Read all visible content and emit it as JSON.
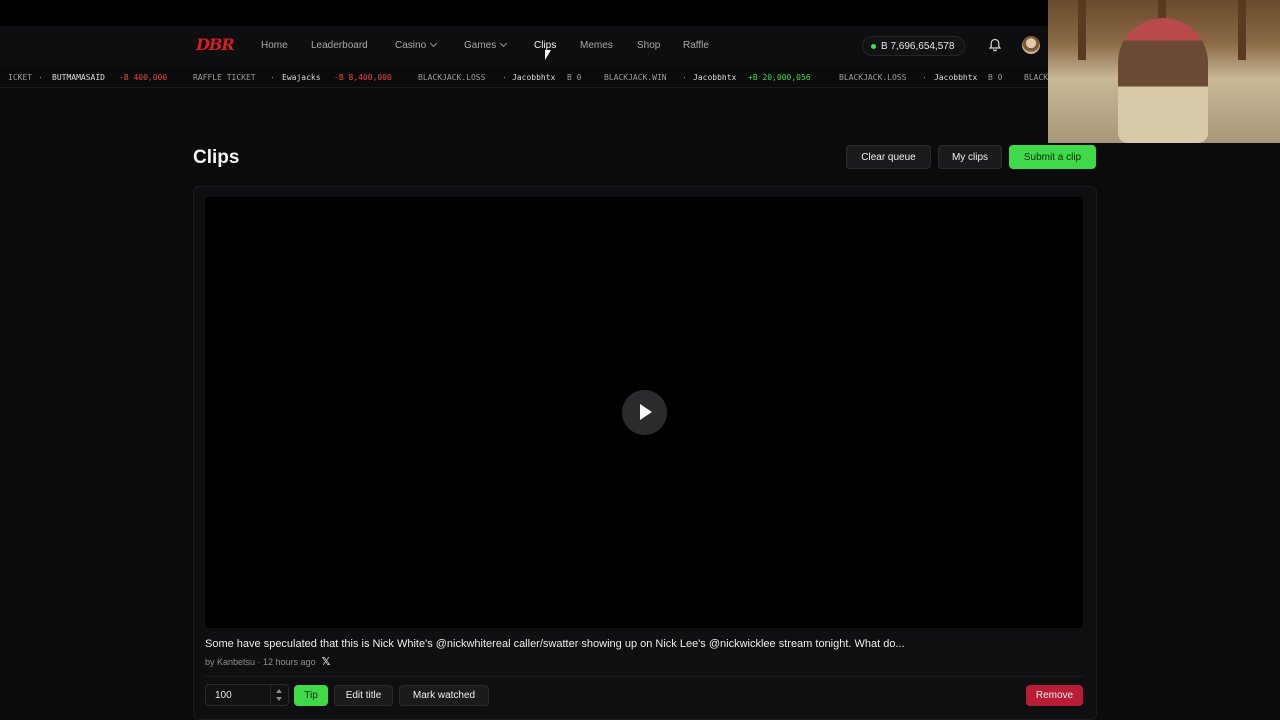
{
  "brand": {
    "logo_text": "DBR",
    "accent": "#d61f1f"
  },
  "nav": {
    "items": [
      {
        "label": "Home"
      },
      {
        "label": "Leaderboard"
      },
      {
        "label": "Casino",
        "has_dropdown": true
      },
      {
        "label": "Games",
        "has_dropdown": true
      },
      {
        "label": "Clips",
        "active": true
      },
      {
        "label": "Memes"
      },
      {
        "label": "Shop"
      },
      {
        "label": "Raffle"
      }
    ],
    "balance": "B 7,696,654,578",
    "icons": [
      "bell-icon",
      "avatar"
    ]
  },
  "ticker": [
    {
      "label": "ICKET",
      "kind": "label"
    },
    {
      "label": "BUTMAMASAID",
      "kind": "user"
    },
    {
      "label": "-B 400,000",
      "kind": "neg"
    },
    {
      "label": "RAFFLE TICKET",
      "kind": "label"
    },
    {
      "label": "Ewajacks",
      "kind": "user"
    },
    {
      "label": "-B 8,400,000",
      "kind": "neg"
    },
    {
      "label": "BLACKJACK.LOSS",
      "kind": "label"
    },
    {
      "label": "Jacobbhtx",
      "kind": "user"
    },
    {
      "label": "B 0",
      "kind": "label"
    },
    {
      "label": "BLACKJACK.WIN",
      "kind": "label"
    },
    {
      "label": "Jacobbhtx",
      "kind": "user"
    },
    {
      "label": "+B 20,000,056",
      "kind": "pos"
    },
    {
      "label": "BLACKJACK.LOSS",
      "kind": "label"
    },
    {
      "label": "Jacobbhtx",
      "kind": "user"
    },
    {
      "label": "B 0",
      "kind": "label"
    },
    {
      "label": "BLACK",
      "kind": "label"
    }
  ],
  "page": {
    "title": "Clips",
    "buttons": {
      "clear_queue": "Clear queue",
      "my_clips": "My clips",
      "submit": "Submit a clip"
    }
  },
  "clip": {
    "title": "Some have speculated that this is Nick White's @nickwhitereal caller/swatter showing up on Nick Lee's @nickwicklee stream tonight. What do...",
    "author_line": "by Kanbetsu · 12 hours ago",
    "source_icon": "x-icon",
    "tip_amount": "100",
    "actions": {
      "tip": "Tip",
      "edit_title": "Edit title",
      "mark_watched": "Mark watched",
      "remove": "Remove"
    }
  },
  "colors": {
    "green": "#3fd94a",
    "red": "#b81d35",
    "positive": "#3ddc4d",
    "negative": "#e54646"
  }
}
